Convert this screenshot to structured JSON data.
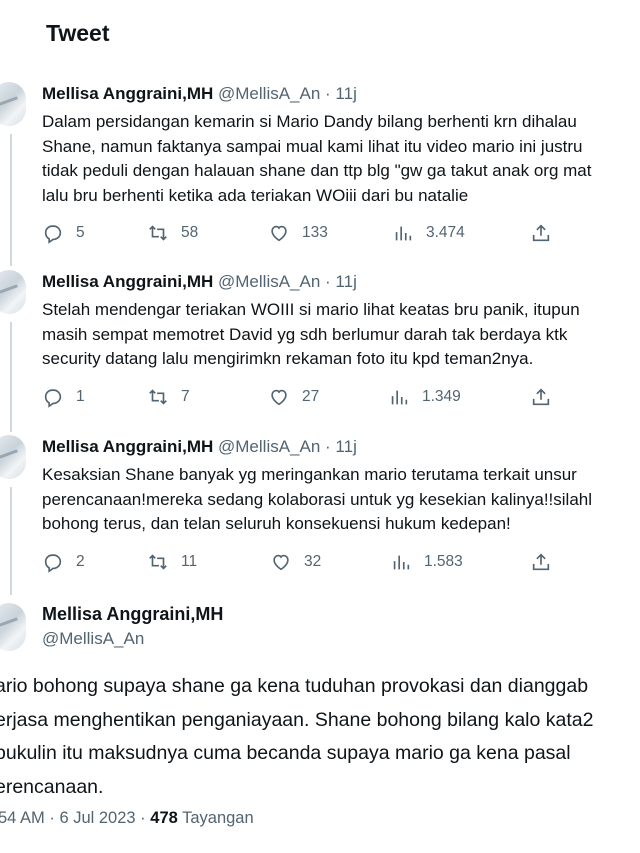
{
  "header": {
    "title": "Tweet"
  },
  "tweets": [
    {
      "name": "Mellisa Anggraini,MH",
      "handle": "@MellisA_An",
      "time": "· 11j",
      "lines": [
        "Dalam persidangan kemarin si Mario Dandy bilang berhenti krn dihalau",
        "Shane, namun faktanya sampai mual kami lihat itu video mario ini justru",
        "tidak peduli dengan halauan shane dan ttp blg \"gw ga takut anak org mat",
        "lalu bru berhenti ketika ada teriakan WOiii dari bu natalie"
      ],
      "replies": "5",
      "retweets": "58",
      "likes": "133",
      "views": "3.474"
    },
    {
      "name": "Mellisa Anggraini,MH",
      "handle": "@MellisA_An",
      "time": "· 11j",
      "lines": [
        "Stelah mendengar teriakan WOIII si mario lihat keatas bru panik, itupun",
        "masih sempat memotret David yg sdh berlumur darah tak berdaya ktk",
        "security datang lalu mengirimkn rekaman foto itu kpd teman2nya."
      ],
      "replies": "1",
      "retweets": "7",
      "likes": "27",
      "views": "1.349"
    },
    {
      "name": "Mellisa Anggraini,MH",
      "handle": "@MellisA_An",
      "time": "· 11j",
      "lines": [
        "Kesaksian Shane banyak yg meringankan mario terutama terkait unsur",
        "perencanaan!mereka sedang kolaborasi untuk yg kesekian kalinya!!silahl",
        "bohong terus, dan telan seluruh konsekuensi hukum kedepan!"
      ],
      "replies": "2",
      "retweets": "11",
      "likes": "32",
      "views": "1.583"
    }
  ],
  "main": {
    "name": "Mellisa Anggraini,MH",
    "handle": "@MellisA_An",
    "lines": [
      "ario bohong supaya shane ga kena tuduhan provokasi dan dianggab",
      "erjasa menghentikan penganiayaan. Shane bohong bilang kalo kata2",
      "pukulin itu maksudnya cuma becanda supaya mario ga kena pasal",
      "erencanaan."
    ],
    "timestamp": "54 AM · 6 Jul 2023 ·",
    "views_count": "478",
    "views_label": "Tayangan"
  },
  "icons": {
    "reply": "reply-icon",
    "retweet": "retweet-icon",
    "like": "like-icon",
    "views": "views-icon",
    "share": "share-icon"
  },
  "colors": {
    "text": "#0f1419",
    "secondary": "#536471",
    "line": "#cfd9de"
  }
}
